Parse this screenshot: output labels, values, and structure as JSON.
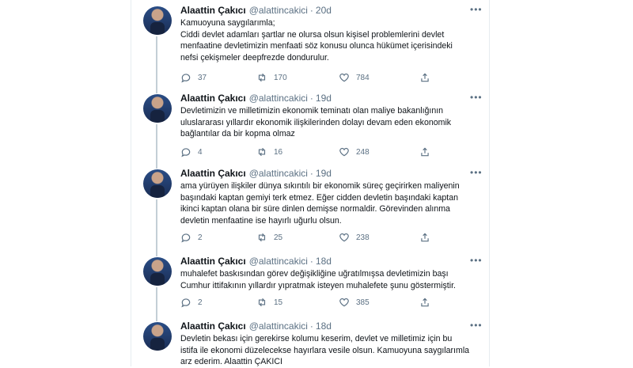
{
  "colors": {
    "text": "#0f1419",
    "muted": "#5b7083",
    "border": "#e6ecf0",
    "thread": "#c4cfd6"
  },
  "tweets": [
    {
      "name": "Alaattin Çakıcı",
      "handle": "@alattincakici",
      "time": "20d",
      "text": "Kamuoyuna saygılarımla;\nCiddi devlet adamları şartlar ne olursa olsun kişisel problemlerini devlet\nmenfaatine devletimizin menfaati söz konusu olunca hükümet içerisindeki\nnefsi çekişmeler deepfrezde dondurulur.",
      "replies": "37",
      "retweets": "170",
      "likes": "784"
    },
    {
      "name": "Alaattin Çakıcı",
      "handle": "@alattincakici",
      "time": "19d",
      "text": "Devletimizin ve milletimizin ekonomik teminatı olan maliye bakanlığının\nuluslararası yıllardır ekonomik ilişkilerinden dolayı devam eden ekonomik\nbağlantılar da bir kopma olmaz",
      "replies": "4",
      "retweets": "16",
      "likes": "248"
    },
    {
      "name": "Alaattin Çakıcı",
      "handle": "@alattincakici",
      "time": "19d",
      "text": "ama yürüyen ilişkiler dünya sıkıntılı bir ekonomik süreç geçirirken maliyenin\nbaşındaki kaptan gemiyi terk etmez. Eğer cidden devletin başındaki kaptan\nikinci kaptan olana bir süre dinlen demişse normaldir. Görevinden alınma\ndevletin menfaatine ise hayırlı uğurlu olsun.",
      "replies": "2",
      "retweets": "25",
      "likes": "238"
    },
    {
      "name": "Alaattin Çakıcı",
      "handle": "@alattincakici",
      "time": "18d",
      "text": "muhalefet baskısından görev değişikliğine uğratılmışsa devletimizin başı\nCumhur ittifakının yıllardır yıpratmak isteyen muhalefete şunu göstermiştir.",
      "replies": "2",
      "retweets": "15",
      "likes": "385"
    },
    {
      "name": "Alaattin Çakıcı",
      "handle": "@alattincakici",
      "time": "18d",
      "text": "Devletin bekası için gerekirse kolumu keserim, devlet ve milletimiz için bu\nistifa ile ekonomi düzelecekse hayırlara vesile olsun. Kamuoyuna saygılarımla\narz ederim. Alaattin ÇAKICI",
      "replies": "",
      "retweets": "",
      "likes": ""
    }
  ]
}
